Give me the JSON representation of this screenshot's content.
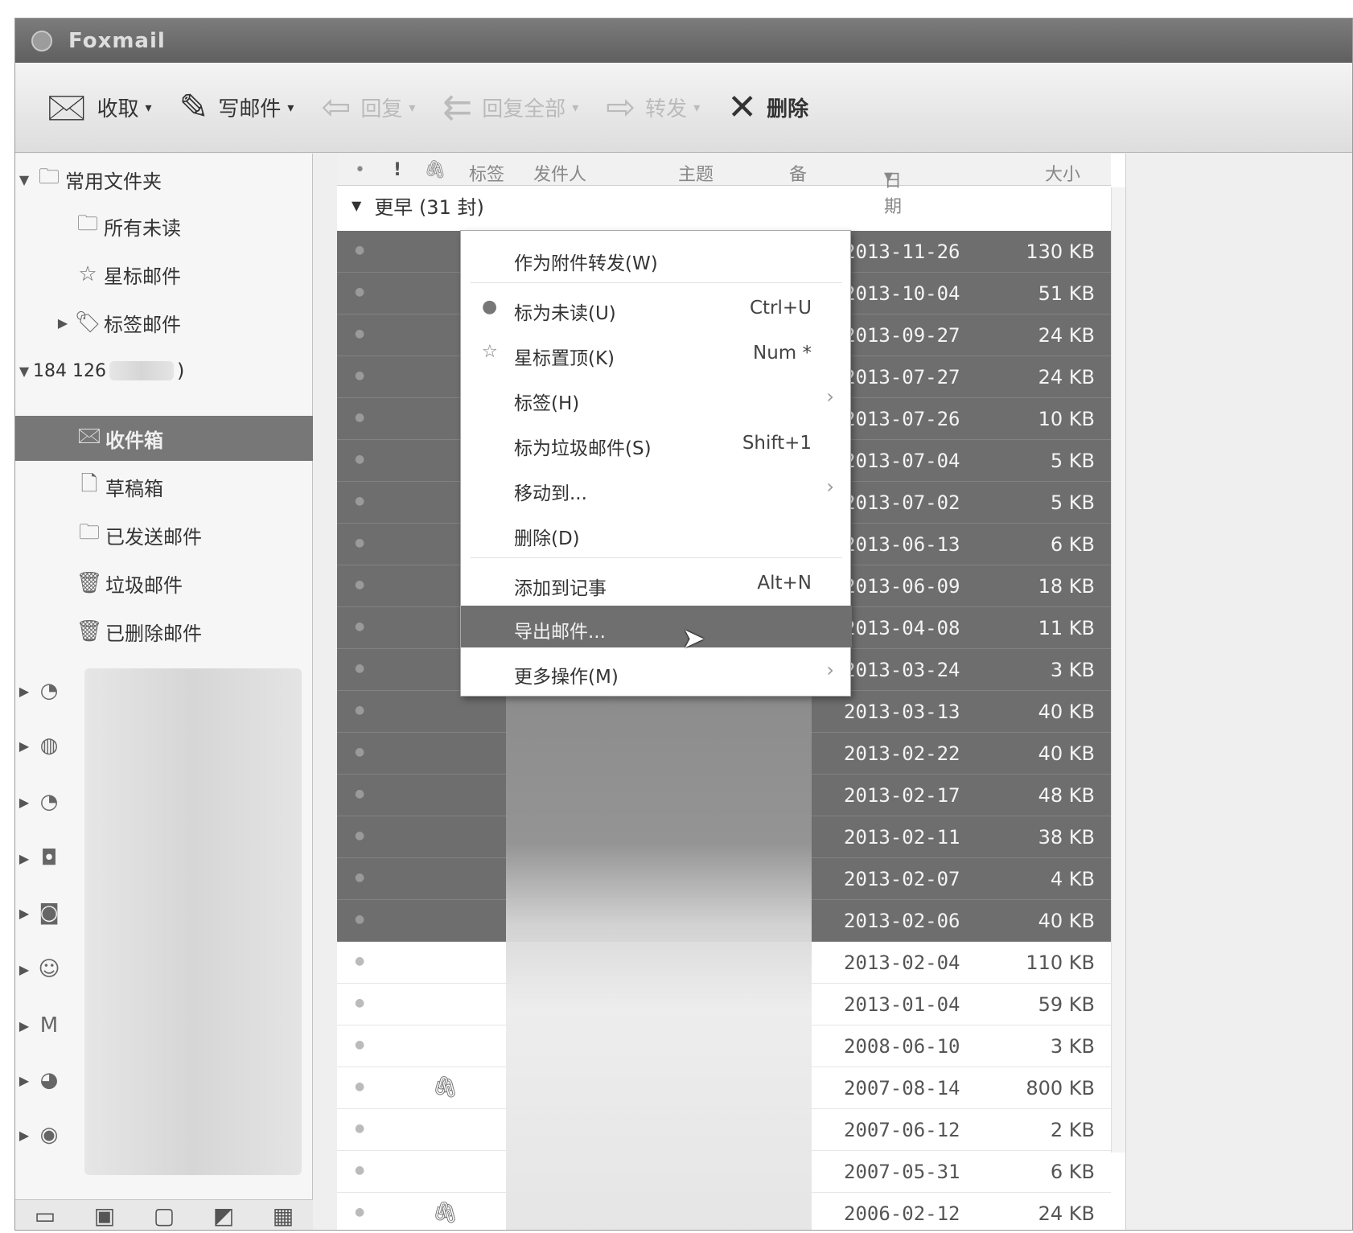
{
  "app": {
    "title": "Foxmail"
  },
  "toolbar": {
    "receive": "收取",
    "compose": "写邮件",
    "reply": "回复",
    "reply_all": "回复全部",
    "forward": "转发",
    "delete": "删除"
  },
  "sidebar": {
    "common_folders": "常用文件夹",
    "all_unread": "所有未读",
    "starred": "星标邮件",
    "tagged": "标签邮件",
    "account_prefix": "184 126",
    "account_suffix": ")",
    "inbox": "收件箱",
    "drafts": "草稿箱",
    "sent": "已发送邮件",
    "junk": "垃圾邮件",
    "deleted": "已删除邮件"
  },
  "columns": {
    "dot": "•",
    "flag": "!",
    "attach": "🖇",
    "tag": "标签",
    "sender": "发件人",
    "subject": "主题",
    "mark": "备",
    "date": "日期",
    "size": "大小"
  },
  "group": {
    "label": "更早 (31 封)"
  },
  "rows": [
    {
      "date": "2013-11-26",
      "size": "130 KB",
      "selected": true,
      "attach": false
    },
    {
      "date": "2013-10-04",
      "size": "51 KB",
      "selected": true,
      "attach": false
    },
    {
      "date": "2013-09-27",
      "size": "24 KB",
      "selected": true,
      "attach": false
    },
    {
      "date": "2013-07-27",
      "size": "24 KB",
      "selected": true,
      "attach": false
    },
    {
      "date": "2013-07-26",
      "size": "10 KB",
      "selected": true,
      "attach": false
    },
    {
      "date": "2013-07-04",
      "size": "5 KB",
      "selected": true,
      "attach": false
    },
    {
      "date": "2013-07-02",
      "size": "5 KB",
      "selected": true,
      "attach": false
    },
    {
      "date": "2013-06-13",
      "size": "6 KB",
      "selected": true,
      "attach": false
    },
    {
      "date": "2013-06-09",
      "size": "18 KB",
      "selected": true,
      "attach": false
    },
    {
      "date": "2013-04-08",
      "size": "11 KB",
      "selected": true,
      "attach": false
    },
    {
      "date": "2013-03-24",
      "size": "3 KB",
      "selected": true,
      "attach": false
    },
    {
      "date": "2013-03-13",
      "size": "40 KB",
      "selected": true,
      "attach": false
    },
    {
      "date": "2013-02-22",
      "size": "40 KB",
      "selected": true,
      "attach": false
    },
    {
      "date": "2013-02-17",
      "size": "48 KB",
      "selected": true,
      "attach": false
    },
    {
      "date": "2013-02-11",
      "size": "38 KB",
      "selected": true,
      "attach": false
    },
    {
      "date": "2013-02-07",
      "size": "4 KB",
      "selected": true,
      "attach": false
    },
    {
      "date": "2013-02-06",
      "size": "40 KB",
      "selected": true,
      "attach": false
    },
    {
      "date": "2013-02-04",
      "size": "110 KB",
      "selected": false,
      "attach": false
    },
    {
      "date": "2013-01-04",
      "size": "59 KB",
      "selected": false,
      "attach": false
    },
    {
      "date": "2008-06-10",
      "size": "3 KB",
      "selected": false,
      "attach": false
    },
    {
      "date": "2007-08-14",
      "size": "800 KB",
      "selected": false,
      "attach": true
    },
    {
      "date": "2007-06-12",
      "size": "2 KB",
      "selected": false,
      "attach": false
    },
    {
      "date": "2007-05-31",
      "size": "6 KB",
      "selected": false,
      "attach": false
    },
    {
      "date": "2006-02-12",
      "size": "24 KB",
      "selected": false,
      "attach": true
    }
  ],
  "context_menu": {
    "forward_as_attachment": "作为附件转发(W)",
    "mark_unread": "标为未读(U)",
    "mark_unread_shortcut": "Ctrl+U",
    "star": "星标置顶(K)",
    "star_shortcut": "Num *",
    "tag": "标签(H)",
    "mark_junk": "标为垃圾邮件(S)",
    "mark_junk_shortcut": "Shift+1",
    "move_to": "移动到...",
    "delete": "删除(D)",
    "add_to_notes": "添加到记事",
    "add_to_notes_shortcut": "Alt+N",
    "export": "导出邮件...",
    "more": "更多操作(M)"
  },
  "colors": {
    "selection": "#6e6e6e",
    "titlebar": "#6a6a6a",
    "menu_highlight": "#6f6f6f"
  }
}
